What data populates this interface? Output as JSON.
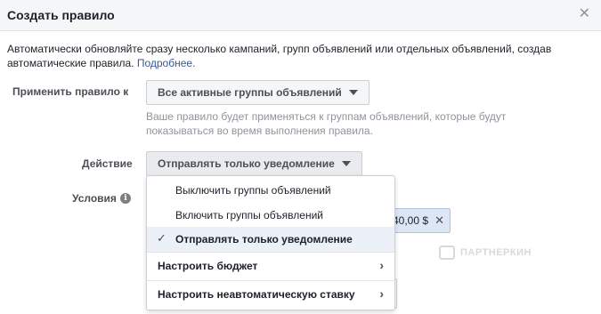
{
  "dialog": {
    "title": "Создать правило",
    "close_icon": "close-icon",
    "description": "Автоматически обновляйте сразу несколько кампаний, групп объявлений или отдельных объявлений, создав автоматические правила.",
    "more_link": "Подробнее."
  },
  "apply": {
    "label": "Применить правило к",
    "value": "Все активные группы объявлений",
    "hint": "Ваше правило будет применяться к группам объявлений, которые будут показываться во время выполнения правила."
  },
  "action": {
    "label": "Действие",
    "value": "Отправлять только уведомление",
    "options": [
      {
        "label": "Выключить группы объявлений",
        "selected": false,
        "submenu": false
      },
      {
        "label": "Включить группы объявлений",
        "selected": false,
        "submenu": false
      },
      {
        "label": "Отправлять только уведомление",
        "selected": true,
        "submenu": false
      },
      {
        "label": "Настроить бюджет",
        "selected": false,
        "submenu": true
      },
      {
        "label": "Настроить неавтоматическую ставку",
        "selected": false,
        "submenu": true
      }
    ]
  },
  "conditions": {
    "label": "Условия",
    "chip_value": "40,00 $"
  },
  "watermark": {
    "text": "ПАРТНЕРКИН"
  },
  "colors": {
    "link": "#365899",
    "selected_bg": "#ecf0f7",
    "chip_bg": "#dde6f5"
  }
}
